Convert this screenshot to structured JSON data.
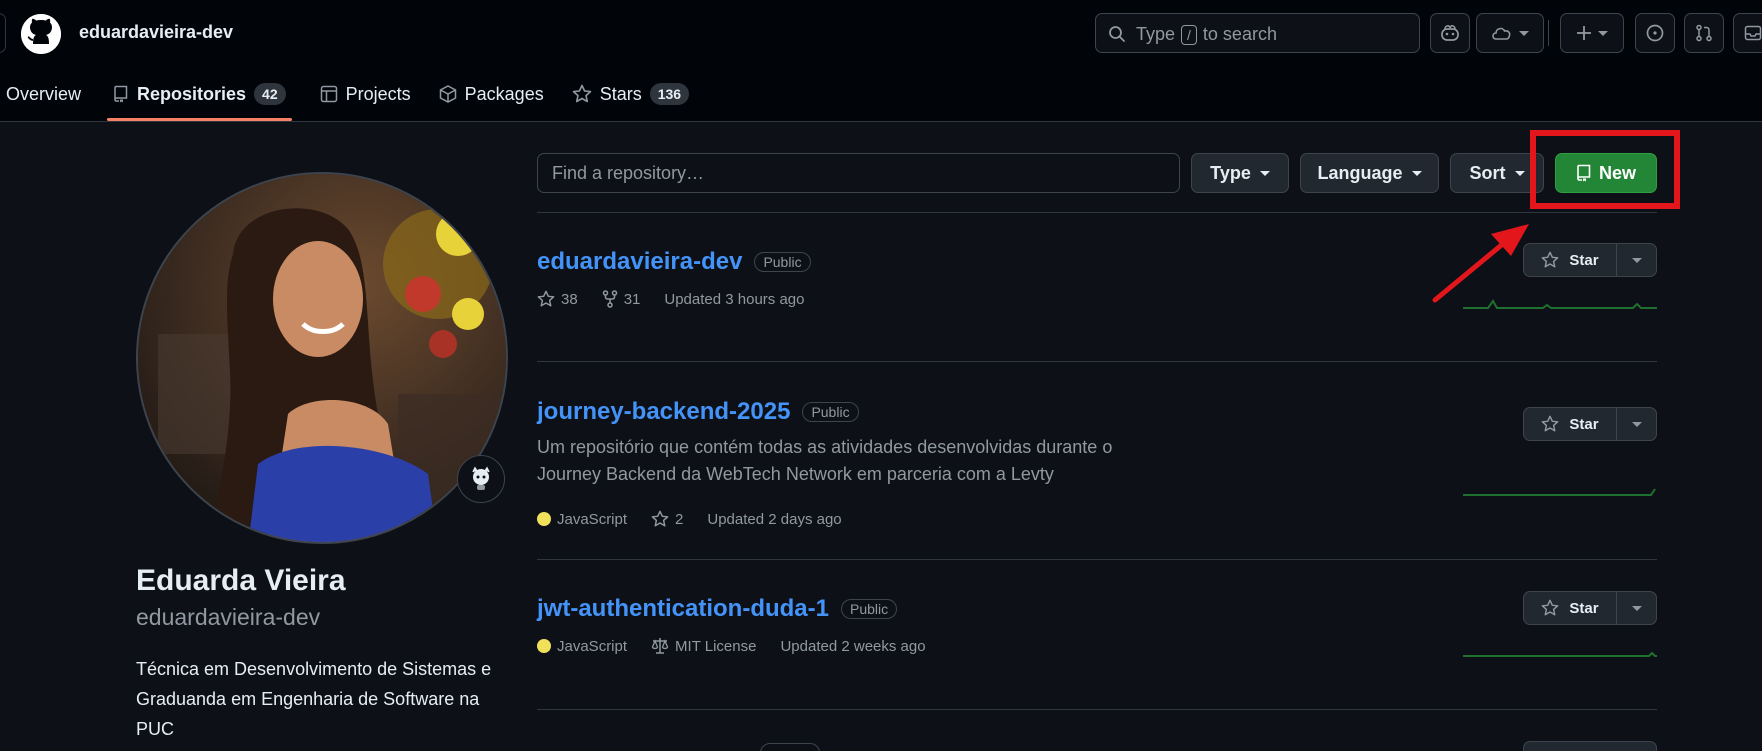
{
  "header": {
    "username": "eduardavieira-dev",
    "search_prefix": "Type",
    "search_key": "/",
    "search_suffix": "to search"
  },
  "tabs": [
    {
      "label": "Overview",
      "counter": null
    },
    {
      "label": "Repositories",
      "counter": "42"
    },
    {
      "label": "Projects",
      "counter": null
    },
    {
      "label": "Packages",
      "counter": null
    },
    {
      "label": "Stars",
      "counter": "136"
    }
  ],
  "profile": {
    "name": "Eduarda Vieira",
    "login": "eduardavieira-dev",
    "bio": "Técnica em Desenvolvimento de Sistemas e Graduanda em Engenharia de Software na PUC"
  },
  "filters": {
    "search_placeholder": "Find a repository…",
    "type_label": "Type",
    "language_label": "Language",
    "sort_label": "Sort",
    "new_label": "New"
  },
  "star_label": "Star",
  "repos": [
    {
      "name": "eduardavieira-dev",
      "visibility": "Public",
      "description": "",
      "stars": "38",
      "forks": "31",
      "updated": "Updated 3 hours ago"
    },
    {
      "name": "journey-backend-2025",
      "visibility": "Public",
      "description": "Um repositório que contém todas as atividades desenvolvidas durante o Journey Backend da WebTech Network em parceria com a Levty",
      "language": "JavaScript",
      "stars": "2",
      "updated": "Updated 2 days ago"
    },
    {
      "name": "jwt-authentication-duda-1",
      "visibility": "Public",
      "description": "",
      "language": "JavaScript",
      "license": "MIT License",
      "updated": "Updated 2 weeks ago"
    }
  ],
  "colors": {
    "accent_green": "#238636",
    "link_blue": "#4493f8",
    "highlight_red": "#e3161c",
    "javascript_dot": "#f1e05a",
    "tab_underline": "#f78166"
  }
}
